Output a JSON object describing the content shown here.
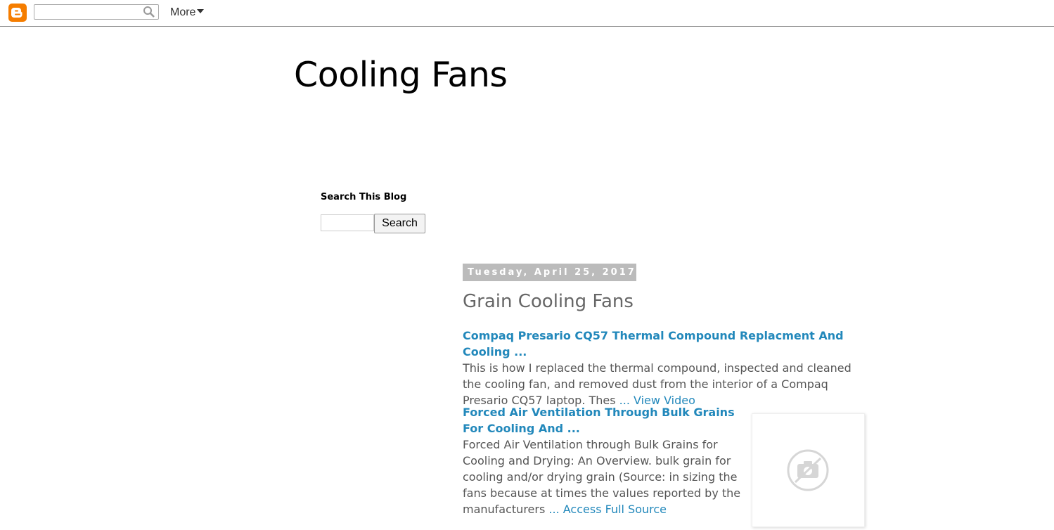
{
  "navbar": {
    "logo_icon": "blogger-logo-icon",
    "search_placeholder": "",
    "search_icon": "search-icon",
    "more_label": "More"
  },
  "blog": {
    "title": "Cooling Fans"
  },
  "sidebar": {
    "search_title": "Search This Blog",
    "search_button": "Search",
    "search_value": ""
  },
  "post": {
    "date": "Tuesday, April 25, 2017",
    "title": "Grain Cooling Fans",
    "entries": [
      {
        "title": "Compaq Presario CQ57 Thermal Compound Replacment And Cooling ...",
        "body": "This is how I replaced the thermal compound, inspected and cleaned the cooling fan, and removed dust from the interior of a Compaq Presario CQ57 laptop. Thes",
        "link": "... View Video"
      },
      {
        "title": "Forced Air Ventilation Through Bulk Grains For Cooling And ...",
        "body": "Forced Air Ventilation through Bulk Grains for Cooling and Drying: An Overview. bulk grain for cooling and/or drying grain (Source: in sizing the fans because at times the values reported by the manufacturers",
        "link": "... Access Full Source",
        "thumbnail_icon": "no-image-camera-icon"
      }
    ]
  },
  "colors": {
    "link": "#2288bb",
    "date_bg": "#bbbbbb",
    "blogger_orange": "#f57d00"
  }
}
